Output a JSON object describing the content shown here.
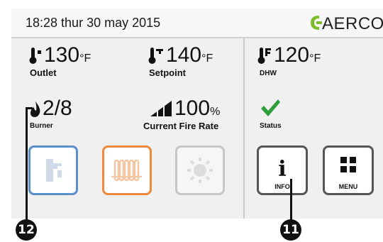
{
  "header": {
    "datetime": "18:28  thur 30 may 2015",
    "logo": "AERCO"
  },
  "outlet": {
    "value": "130",
    "unit": "°F",
    "label": "Outlet",
    "icon": "thermometer-up-icon"
  },
  "setpoint": {
    "value": "140",
    "unit": "°F",
    "label": "Setpoint",
    "icon": "thermometer-target-icon"
  },
  "dhw": {
    "value": "120",
    "unit": "°F",
    "label": "DHW",
    "icon": "thermometer-dhw-icon"
  },
  "burner": {
    "value": "2/8",
    "label": "Burner",
    "icon": "flame-icon"
  },
  "fire_rate": {
    "value": "100",
    "unit": "%",
    "label": "Current Fire Rate",
    "icon": "signal-bars-icon"
  },
  "status": {
    "label": "Status",
    "icon": "checkmark-icon",
    "color": "#2e9e3a"
  },
  "buttons": {
    "dhw_icon": "faucet-icon",
    "heating_icon": "radiator-icon",
    "solar_icon": "sun-icon",
    "info_label": "INFO",
    "menu_label": "MENU"
  },
  "callouts": {
    "burner": "12",
    "info": "11"
  },
  "colors": {
    "dhw_button": "#5a8fc9",
    "heating_button": "#ef8a3c",
    "disabled_button": "#c6c6c6"
  }
}
